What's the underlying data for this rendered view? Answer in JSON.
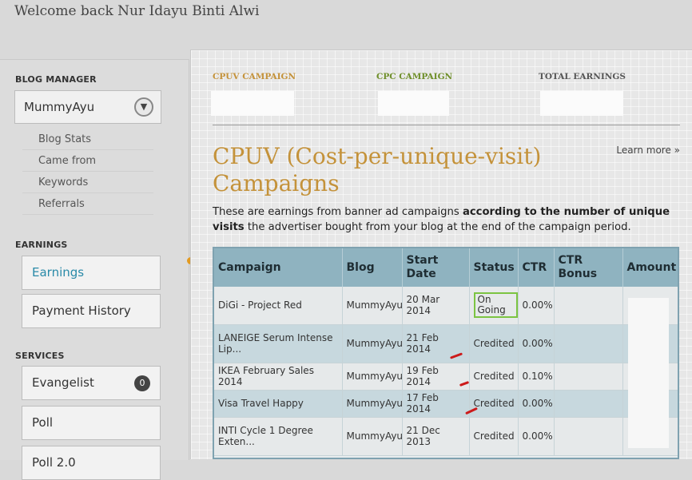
{
  "header": {
    "welcome": "Welcome back Nur Idayu Binti Alwi"
  },
  "sidebar": {
    "blog_manager_heading": "BLOG MANAGER",
    "selected_blog": "MummyAyu",
    "blog_links": [
      "Blog Stats",
      "Came from",
      "Keywords",
      "Referrals"
    ],
    "earnings_heading": "EARNINGS",
    "earnings_items": [
      "Earnings",
      "Payment History"
    ],
    "services_heading": "SERVICES",
    "services_items": [
      {
        "label": "Evangelist",
        "badge": "0"
      },
      {
        "label": "Poll"
      },
      {
        "label": "Poll 2.0"
      }
    ]
  },
  "summary": {
    "cpuv_label": "CPUV CAMPAIGN",
    "cpc_label": "CPC CAMPAIGN",
    "total_label": "TOTAL EARNINGS",
    "cpuv_color": "#c4923a",
    "cpc_color": "#6f8f2a",
    "total_color": "#555555"
  },
  "main": {
    "learn_more": "Learn more »",
    "title": "CPUV (Cost-per-unique-visit) Campaigns",
    "desc_pre": "These are earnings from banner ad campaigns ",
    "desc_bold": "according to the number of unique visits",
    "desc_post": " the advertiser bought from your blog at the end of the campaign period."
  },
  "table": {
    "headers": [
      "Campaign",
      "Blog",
      "Start Date",
      "Status",
      "CTR",
      "CTR Bonus",
      "Amount"
    ],
    "rows": [
      {
        "campaign": "DiGi - Project Red",
        "blog": "MummyAyu",
        "start": "20 Mar 2014",
        "status": "On Going",
        "ctr": "0.00%"
      },
      {
        "campaign": "LANEIGE Serum Intense Lip...",
        "blog": "MummyAyu",
        "start": "21 Feb 2014",
        "status": "Credited",
        "ctr": "0.00%"
      },
      {
        "campaign": "IKEA February Sales 2014",
        "blog": "MummyAyu",
        "start": "19 Feb 2014",
        "status": "Credited",
        "ctr": "0.10%"
      },
      {
        "campaign": "Visa Travel Happy",
        "blog": "MummyAyu",
        "start": "17 Feb 2014",
        "status": "Credited",
        "ctr": "0.00%"
      },
      {
        "campaign": "INTI Cycle 1 Degree Exten...",
        "blog": "MummyAyu",
        "start": "21 Dec 2013",
        "status": "Credited",
        "ctr": "0.00%"
      }
    ]
  }
}
